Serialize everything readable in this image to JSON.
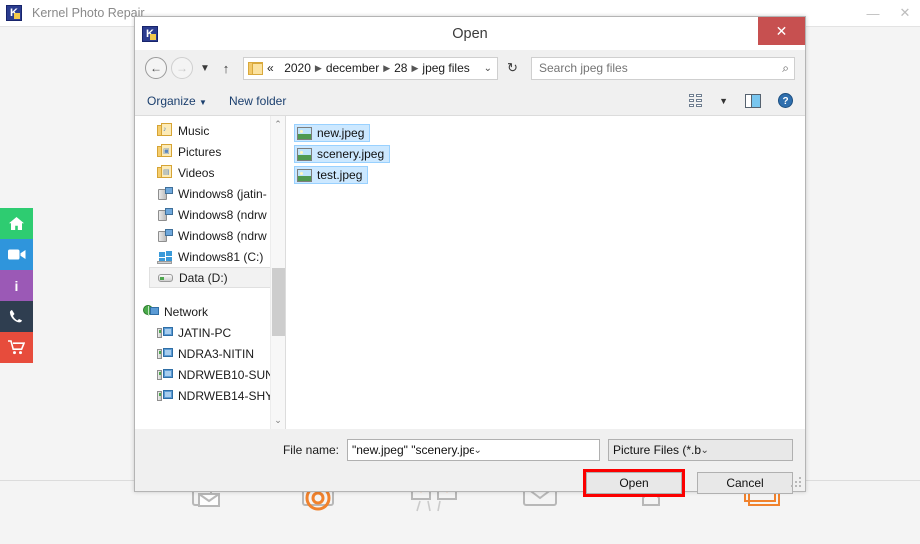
{
  "app": {
    "title": "Kernel Photo Repair",
    "logo_letter": "K",
    "minimize_label": "—",
    "close_label": "✕"
  },
  "rail": [
    {
      "name": "home",
      "glyph": "⌂",
      "color": "#2ecc71"
    },
    {
      "name": "video",
      "glyph": "▶",
      "color": "#2f95dc"
    },
    {
      "name": "info",
      "glyph": "i",
      "color": "#9b59b6"
    },
    {
      "name": "phone",
      "glyph": "✆",
      "color": "#2f3e50"
    },
    {
      "name": "cart",
      "glyph": "🛒",
      "color": "#e74c3c"
    }
  ],
  "dialog": {
    "title": "Open",
    "close_label": "✕",
    "nav": {
      "back_glyph": "←",
      "forward_glyph": "→",
      "history_glyph": "▼",
      "up_glyph": "↑",
      "breadcrumb_prefix": "«",
      "breadcrumb": [
        "2020",
        "december",
        "28",
        "jpeg files"
      ],
      "breadcrumb_separator": "▶",
      "breadcrumb_caret": "⌄",
      "refresh_glyph": "↻",
      "search_placeholder": "Search jpeg files",
      "search_value": "",
      "search_icon": "⌕"
    },
    "toolbar": {
      "organize_label": "Organize",
      "organize_caret": "▼",
      "new_folder_label": "New folder",
      "view_caret": "▼",
      "help_glyph": "?"
    },
    "sidebar": {
      "items": [
        {
          "label": "Music",
          "icon": "folder",
          "selected": false
        },
        {
          "label": "Pictures",
          "icon": "folder",
          "selected": false
        },
        {
          "label": "Videos",
          "icon": "folder",
          "selected": false
        },
        {
          "label": "Windows8 (jatin-",
          "icon": "drive-net",
          "selected": false
        },
        {
          "label": "Windows8 (ndrw",
          "icon": "drive-net",
          "selected": false
        },
        {
          "label": "Windows8 (ndrw",
          "icon": "drive-net",
          "selected": false
        },
        {
          "label": "Windows81 (C:)",
          "icon": "windows-drive",
          "selected": false
        },
        {
          "label": "Data (D:)",
          "icon": "hard-drive",
          "selected": true
        }
      ],
      "network_label": "Network",
      "network_items": [
        {
          "label": "JATIN-PC"
        },
        {
          "label": "NDRA3-NITIN"
        },
        {
          "label": "NDRWEB10-SUN"
        },
        {
          "label": "NDRWEB14-SHY"
        }
      ],
      "scroll_up_glyph": "⌃",
      "scroll_down_glyph": "⌄"
    },
    "files": [
      {
        "name": "new.jpeg",
        "selected": true
      },
      {
        "name": "scenery.jpeg",
        "selected": true
      },
      {
        "name": "test.jpeg",
        "selected": true
      }
    ],
    "form": {
      "file_name_label": "File name:",
      "file_name_value": "\"new.jpeg\" \"scenery.jpeg\" \"test.jpeg\"",
      "file_name_caret": "⌄",
      "filter_value": "Picture Files (*.bmp;*.gif;*.jpg;*",
      "filter_caret": "⌄",
      "open_label": "Open",
      "cancel_label": "Cancel",
      "highlight_color": "#fb0000"
    }
  }
}
